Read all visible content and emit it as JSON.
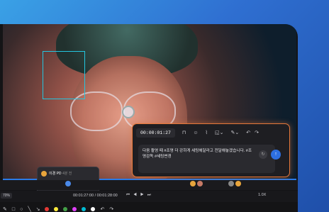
{
  "editor": {
    "timecode": "00:00:01:27",
    "text": "다음 촬영 때 #조명 더 강하게 세팅해달라고 전달해놓겠습니다. #조명감독 #세팅변경"
  },
  "comment": {
    "author": "이경 PD",
    "meta": "4분 전",
    "timecode": "00:01:27:00",
    "text": "아이의 교체"
  },
  "player": {
    "zoom": "70%",
    "current_time": "00:01:27:00",
    "total_time": "00:01:28:00",
    "speed": "1.0X"
  },
  "colors": {
    "accent": "#e5783a",
    "primary": "#2d6fe0",
    "swatches": [
      "#e53935",
      "#ffeb3b",
      "#43a047",
      "#e040fb",
      "#00bcd4",
      "#ffffff"
    ]
  }
}
